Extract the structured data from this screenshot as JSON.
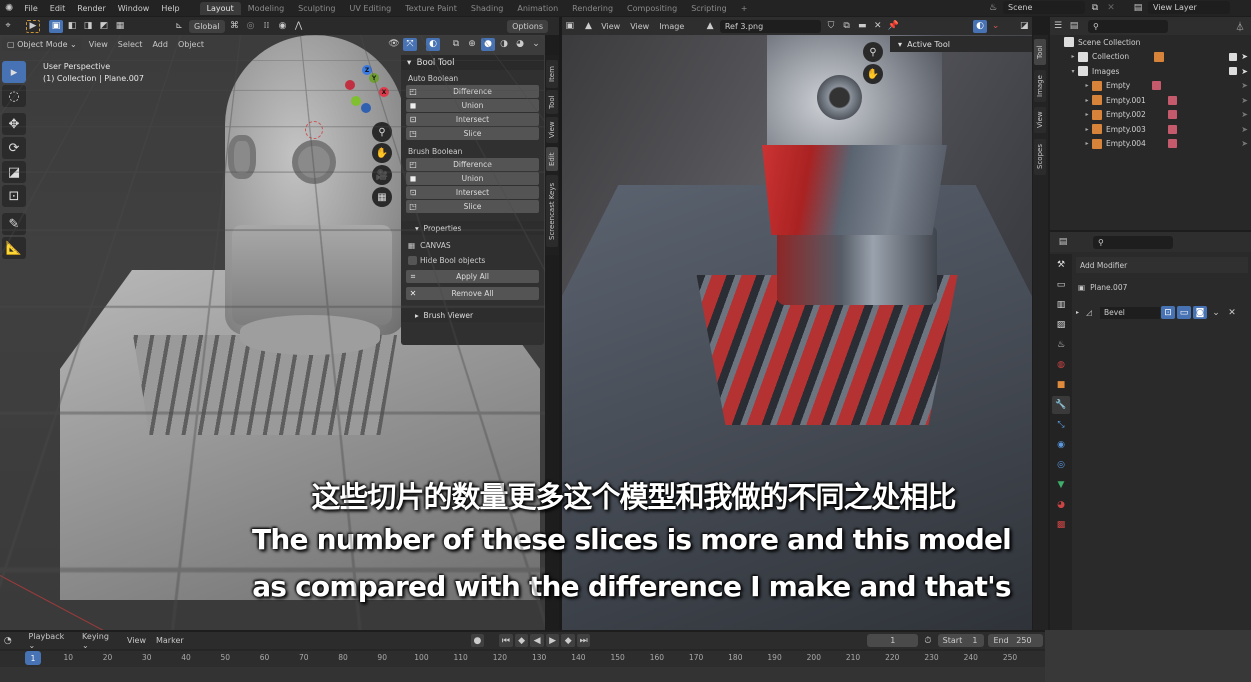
{
  "topbar": {
    "menus": [
      "File",
      "Edit",
      "Render",
      "Window",
      "Help"
    ],
    "workspaces": [
      "Layout",
      "Modeling",
      "Sculpting",
      "UV Editing",
      "Texture Paint",
      "Shading",
      "Animation",
      "Rendering",
      "Compositing",
      "Scripting"
    ],
    "active_workspace": "Layout",
    "add_workspace": "+",
    "scene": "Scene",
    "view_layer": "View Layer"
  },
  "viewport": {
    "transform_orientation": "Global",
    "options_label": "Options",
    "mode": "Object Mode",
    "menus": [
      "View",
      "Select",
      "Add",
      "Object"
    ],
    "info_line1": "User Perspective",
    "info_line2": "(1) Collection | Plane.007",
    "gizmo_axes": {
      "x": "X",
      "y": "Y",
      "z": "Z"
    },
    "tools": [
      "select-box",
      "cursor",
      "move",
      "rotate",
      "scale",
      "transform",
      "annotate",
      "measure"
    ]
  },
  "npanel": {
    "title": "Bool Tool",
    "auto_boolean_label": "Auto Boolean",
    "auto_buttons": [
      "Difference",
      "Union",
      "Intersect",
      "Slice"
    ],
    "brush_boolean_label": "Brush Boolean",
    "brush_buttons": [
      "Difference",
      "Union",
      "Intersect",
      "Slice"
    ],
    "properties_label": "Properties",
    "canvas_label": "CANVAS",
    "hide_bool_label": "Hide Bool objects",
    "hide_bool_checked": false,
    "apply_all": "Apply All",
    "remove_all": "Remove All",
    "brush_viewer": "Brush Viewer",
    "tabs": [
      "Item",
      "Tool",
      "View",
      "Edit",
      "Screencast Keys"
    ],
    "active_tab": "Edit"
  },
  "image_editor": {
    "menus": [
      "View",
      "View",
      "Image"
    ],
    "image_name": "Ref 3.png",
    "active_tool_label": "Active Tool",
    "tabs": [
      "Tool",
      "Image",
      "View",
      "Scopes"
    ]
  },
  "outliner": {
    "root": "Scene Collection",
    "items": [
      {
        "label": "Collection",
        "level": 1,
        "expanded": false,
        "checked": true
      },
      {
        "label": "Images",
        "level": 1,
        "expanded": true,
        "checked": true
      },
      {
        "label": "Empty",
        "level": 2
      },
      {
        "label": "Empty.001",
        "level": 2
      },
      {
        "label": "Empty.002",
        "level": 2
      },
      {
        "label": "Empty.003",
        "level": 2
      },
      {
        "label": "Empty.004",
        "level": 2
      }
    ]
  },
  "properties": {
    "add_modifier": "Add Modifier",
    "object_name": "Plane.007",
    "modifier_name": "Bevel"
  },
  "timeline": {
    "menus": [
      "Playback",
      "Keying",
      "View",
      "Marker"
    ],
    "current_frame": "1",
    "start_label": "Start",
    "start": "1",
    "end_label": "End",
    "end": "250",
    "ticks": [
      "10",
      "20",
      "30",
      "40",
      "50",
      "60",
      "70",
      "80",
      "90",
      "100",
      "110",
      "120",
      "130",
      "140",
      "150",
      "160",
      "170",
      "180",
      "190",
      "200",
      "210",
      "220",
      "230",
      "240",
      "250"
    ],
    "playhead": "1"
  },
  "subtitles": {
    "chinese": "这些切片的数量更多这个模型和我做的不同之处相比",
    "english_line1": "The number of these slices is more and this model",
    "english_line2": "as compared with the difference I make and that's"
  },
  "colors": {
    "accent": "#4772b3",
    "active_bg": "#4772b3"
  }
}
